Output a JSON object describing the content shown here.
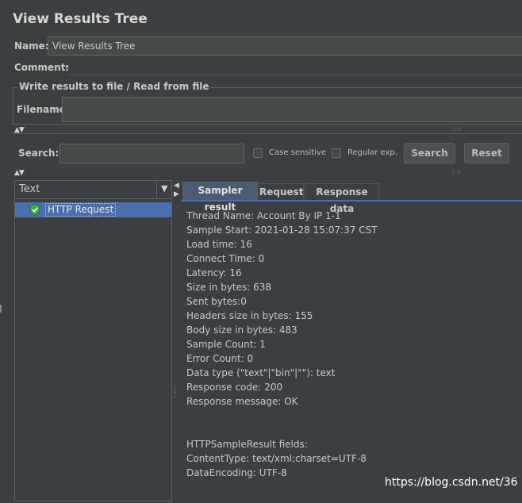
{
  "window": {
    "title": "View Results Tree"
  },
  "name_row": {
    "label": "Name:",
    "value": "View Results Tree"
  },
  "comments_row": {
    "label": "Comments:"
  },
  "file_group": {
    "title": "Write results to file / Read from file",
    "filename_label": "Filename"
  },
  "search_bar": {
    "label": "Search:",
    "search_value": "",
    "case_sensitive_label": "Case sensitive",
    "regexp_label": "Regular exp.",
    "search_button": "Search",
    "reset_button": "Reset"
  },
  "renderer": {
    "selected": "Text",
    "dropdown_icon": "chevron-down-icon"
  },
  "tree": {
    "items": [
      {
        "label": "HTTP Request",
        "icon": "success-shield-icon",
        "selected": true
      }
    ]
  },
  "tabs": [
    {
      "label": "Sampler result",
      "active": true
    },
    {
      "label": "Request",
      "active": false
    },
    {
      "label": "Response data",
      "active": false
    }
  ],
  "sampler_result": {
    "lines": [
      "Thread Name: Account By IP 1-1",
      "Sample Start: 2021-01-28 15:07:37 CST",
      "Load time: 16",
      "Connect Time: 0",
      "Latency: 16",
      "Size in bytes: 638",
      "Sent bytes:0",
      "Headers size in bytes: 155",
      "Body size in bytes: 483",
      "Sample Count: 1",
      "Error Count: 0",
      "Data type (\"text\"|\"bin\"|\"\"): text",
      "Response code: 200",
      "Response message: OK",
      "",
      "",
      "HTTPSampleResult fields:",
      "ContentType: text/xml;charset=UTF-8",
      "DataEncoding: UTF-8"
    ]
  },
  "watermark": "https://blog.csdn.net/36",
  "colors": {
    "background": "#3c3f41",
    "selection": "#4b6eaf",
    "success_icon": "#3fae49"
  }
}
